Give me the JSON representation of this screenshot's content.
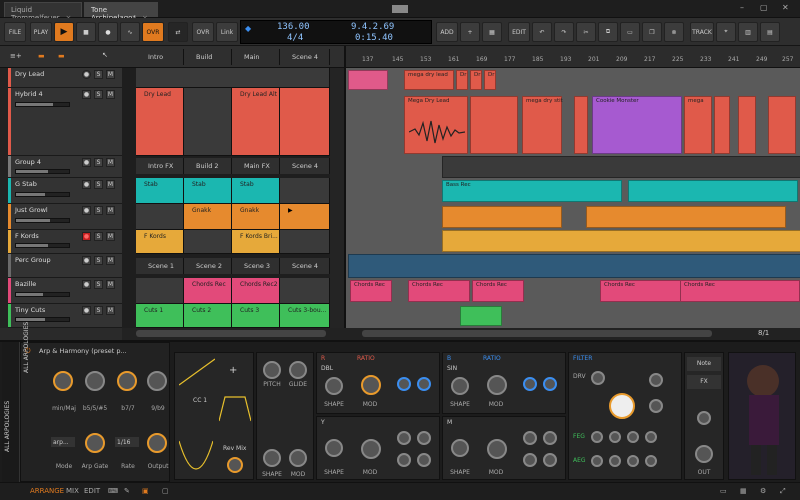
{
  "tabs": [
    {
      "label": "Liquid Trommelfeuer"
    },
    {
      "label": "Tone Archipelago*"
    }
  ],
  "toolbar": {
    "file": "FILE",
    "play_label": "PLAY",
    "ovr": "OVR",
    "ovr2": "OVR",
    "link": "Link",
    "add": "ADD",
    "edit": "EDIT",
    "track": "TRACK"
  },
  "transport": {
    "tempo": "136.00",
    "sig": "4/4",
    "position": "9.4.2.69",
    "time": "0:15.40"
  },
  "tracks": [
    {
      "name": "Dry Lead",
      "color": "#e05a4a"
    },
    {
      "name": "Hybrid 4",
      "color": "#e05a4a"
    },
    {
      "name": "Group 4",
      "color": "#7a7a7a"
    },
    {
      "name": "G Stab",
      "color": "#1bb7b0"
    },
    {
      "name": "Just Growl",
      "color": "#e68a2e"
    },
    {
      "name": "F Kords",
      "color": "#e6a93a"
    },
    {
      "name": "Perc Group",
      "color": "#6a6a6a"
    },
    {
      "name": "Bazille",
      "color": "#e24a7a"
    },
    {
      "name": "Tiny Cuts",
      "color": "#3fbf5a"
    }
  ],
  "scenes_top": [
    "Intro",
    "Build",
    "Main",
    "Scene 4"
  ],
  "scenes_group": [
    "Intro FX",
    "Build 2",
    "Main FX",
    "Scene 4"
  ],
  "scenes_perc": [
    "Scene 1",
    "Scene 2",
    "Scene 3",
    "Scene 4"
  ],
  "clips": {
    "dry_lead": [
      "Dry Lead",
      "",
      "Dry Lead Alt",
      ""
    ],
    "g_stab": [
      "Stab",
      "Stab",
      "Stab",
      ""
    ],
    "just_growl": [
      "",
      "Gnakk",
      "Gnakk",
      ""
    ],
    "f_kords": [
      "F Kords",
      "",
      "F Kords Bri...",
      ""
    ],
    "bazille": [
      "",
      "Chords Rec",
      "Chords Rec2",
      ""
    ],
    "tiny_cuts": [
      "Cuts 1",
      "Cuts 2",
      "Cuts 3",
      "Cuts 3-bou..."
    ]
  },
  "ruler": [
    "137",
    "145",
    "153",
    "161",
    "169",
    "177",
    "185",
    "193",
    "201",
    "209",
    "217",
    "225",
    "233",
    "241",
    "249",
    "257"
  ],
  "arr_clips": {
    "mega_dry_lead": "mega dry lead",
    "mega_dry_lead2": "Mega Dry Lead",
    "mega_dry": "mega dry stit",
    "cookie": "Cookie Monster",
    "mega": "mega",
    "chords_rec": "Chords Rec",
    "bass": "Bass Rec",
    "dr": "Dr"
  },
  "zoom": "8/1",
  "device": {
    "header": "Arp & Harmony (preset p...",
    "side_label": "ALL ARPOLOGIES",
    "side_label2": "ALL ARPOLOGIES",
    "knobs": [
      "min/Maj",
      "b5/5/#5",
      "b7/7",
      "9/b9",
      "Mode",
      "Arp Gate",
      "Rate",
      "Output"
    ],
    "arp": "arp...",
    "rate": "1/16",
    "pitch": "PITCH",
    "glide": "GLIDE",
    "cc1": "CC 1",
    "revmix": "Rev Mix",
    "shape": "SHAPE",
    "mod": "MOD",
    "filter": "FILTER",
    "drv": "DRV",
    "feg": "FEG",
    "aeg": "AEG",
    "out": "OUT",
    "note": "Note",
    "fx": "FX",
    "osc_a": "R",
    "osc_b": "B",
    "ratio": "RATIO",
    "dbl": "DBL",
    "sin": "SIN",
    "y": "Y",
    "m": "M"
  },
  "status": {
    "arrange": "ARRANGE",
    "mix": "MIX",
    "edit": "EDIT"
  }
}
